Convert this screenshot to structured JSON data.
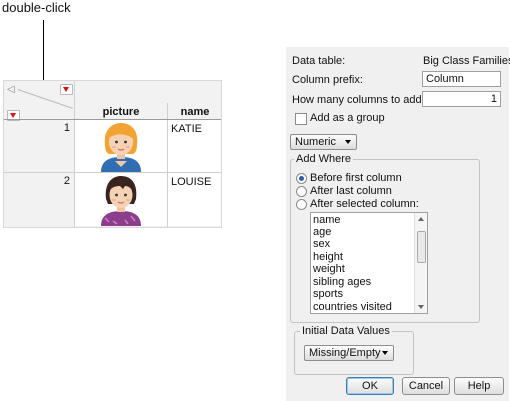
{
  "callout": {
    "text": "double-click"
  },
  "table": {
    "columns": [
      "picture",
      "name"
    ],
    "rows": [
      {
        "number": "1",
        "name": "KATIE"
      },
      {
        "number": "2",
        "name": "LOUISE"
      }
    ]
  },
  "dialog": {
    "data_table_label": "Data table:",
    "data_table_value": "Big Class Families",
    "column_prefix_label": "Column prefix:",
    "column_prefix_value": "Column",
    "count_label": "How many columns to add:",
    "count_value": "1",
    "add_as_group_label": "Add as a group",
    "type_dropdown": "Numeric",
    "add_where": {
      "title": "Add Where",
      "options": [
        "Before first column",
        "After last column",
        "After selected column:"
      ],
      "selected_index": 0
    },
    "columns_list": [
      "name",
      "age",
      "sex",
      "height",
      "weight",
      "sibling ages",
      "sports",
      "countries visited"
    ],
    "initial_values": {
      "title": "Initial Data Values",
      "dropdown": "Missing/Empty"
    },
    "buttons": {
      "ok": "OK",
      "cancel": "Cancel",
      "help": "Help"
    }
  },
  "colors": {
    "red_triangle": "#dd1111",
    "default_button_border": "#3c7fb1",
    "radio_selected": "#2a5ca8"
  }
}
